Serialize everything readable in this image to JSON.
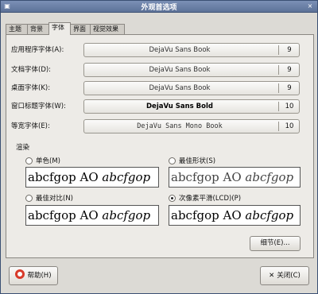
{
  "window": {
    "title": "外观首选项",
    "close_glyph": "×"
  },
  "tabs": [
    {
      "label": "主题"
    },
    {
      "label": "背景"
    },
    {
      "label": "字体"
    },
    {
      "label": "界面"
    },
    {
      "label": "视觉效果"
    }
  ],
  "font_rows": [
    {
      "label": "应用程序字体(A):",
      "font": "DejaVu Sans Book",
      "size": "9"
    },
    {
      "label": "文档字体(D):",
      "font": "DejaVu Sans Book",
      "size": "9"
    },
    {
      "label": "桌面字体(K):",
      "font": "DejaVu Sans Book",
      "size": "9"
    },
    {
      "label": "窗口标题字体(W):",
      "font": "DejaVu Sans Bold",
      "size": "10"
    },
    {
      "label": "等宽字体(E):",
      "font": "DejaVu Sans Mono Book",
      "size": "10"
    }
  ],
  "rendering": {
    "heading": "渲染",
    "options": [
      {
        "label": "单色(M)",
        "selected": false
      },
      {
        "label": "最佳形状(S)",
        "selected": false
      },
      {
        "label": "最佳对比(N)",
        "selected": false
      },
      {
        "label": "次像素平滑(LCD)(P)",
        "selected": true
      }
    ],
    "sample_text": "abcfgop AO",
    "sample_italic": "abcfgop"
  },
  "buttons": {
    "details": "细节(E)...",
    "help": "帮助(H)",
    "close": "关闭(C)"
  },
  "colors": {
    "titlebar": "#6f84aa",
    "panel": "#edebe7",
    "window": "#dcdad5"
  }
}
